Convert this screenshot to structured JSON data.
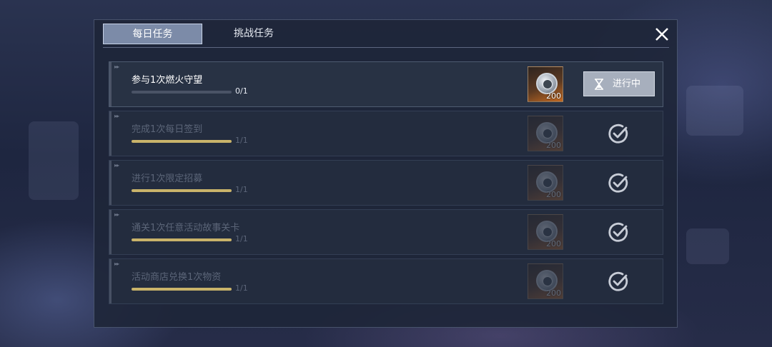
{
  "tabs": [
    {
      "label": "每日任务",
      "active": true
    },
    {
      "label": "挑战任务",
      "active": false
    }
  ],
  "close_icon": "close-icon",
  "tasks": [
    {
      "title": "参与1次燃火守望",
      "progress": "0/1",
      "fraction": 0,
      "reward_qty": "200",
      "status": "进行中",
      "state": "in-progress"
    },
    {
      "title": "完成1次每日签到",
      "progress": "1/1",
      "fraction": 1,
      "reward_qty": "200",
      "state": "completed"
    },
    {
      "title": "进行1次限定招募",
      "progress": "1/1",
      "fraction": 1,
      "reward_qty": "200",
      "state": "completed"
    },
    {
      "title": "通关1次任意活动故事关卡",
      "progress": "1/1",
      "fraction": 1,
      "reward_qty": "200",
      "state": "completed"
    },
    {
      "title": "活动商店兑换1次物资",
      "progress": "1/1",
      "fraction": 1,
      "reward_qty": "200",
      "state": "completed"
    }
  ],
  "colors": {
    "accent_bar": "#c9b36a",
    "panel": "#1e2638",
    "button": "#a7afbd"
  }
}
